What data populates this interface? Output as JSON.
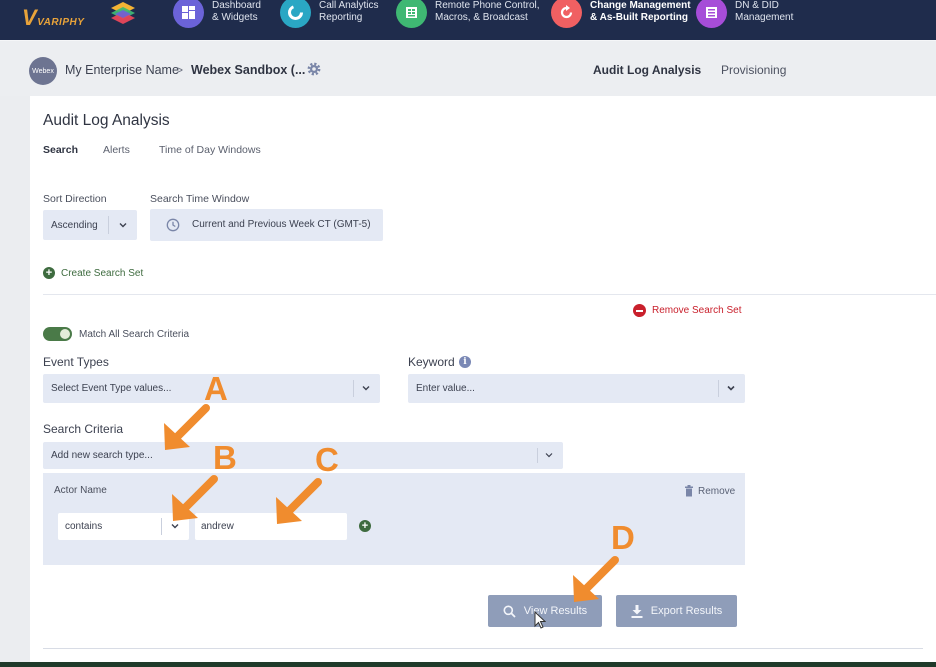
{
  "nav": {
    "logo": "VARIPHY",
    "items": [
      {
        "line1": "Dashboard",
        "line2": "& Widgets",
        "color": "#6b63d8"
      },
      {
        "line1": "Call Analytics",
        "line2": "Reporting",
        "color": "#2aa7c4"
      },
      {
        "line1": "Remote Phone Control,",
        "line2": "Macros, & Broadcast",
        "color": "#3fb873"
      },
      {
        "line1": "Change Management",
        "line2": "& As-Built Reporting",
        "color": "#f06062"
      },
      {
        "line1": "DN & DID",
        "line2": "Management",
        "color": "#a64dd8"
      }
    ]
  },
  "breadcrumb": {
    "avatar": "Webex",
    "enterprise": "My Enterprise Name",
    "separator": ">",
    "cluster": "Webex Sandbox (...",
    "links": [
      "Audit Log Analysis",
      "Provisioning"
    ]
  },
  "page": {
    "title": "Audit Log Analysis",
    "tabs": [
      "Search",
      "Alerts",
      "Time of Day Windows"
    ],
    "sort_direction": {
      "label": "Sort Direction",
      "value": "Ascending"
    },
    "time_window": {
      "label": "Search Time Window",
      "value": "Current and Previous Week CT (GMT-5)"
    },
    "create_search_set": "Create Search Set",
    "remove_search_set": "Remove Search Set",
    "match_all": "Match All Search Criteria",
    "match_all_on": true,
    "event_types": {
      "label": "Event Types",
      "placeholder": "Select Event Type values..."
    },
    "keyword": {
      "label": "Keyword",
      "placeholder": "Enter value..."
    },
    "search_criteria": {
      "label": "Search Criteria",
      "placeholder": "Add new search type..."
    },
    "actor": {
      "label": "Actor Name",
      "remove": "Remove",
      "operator": "contains",
      "value": "andrew"
    },
    "view_results": "View Results",
    "export_results": "Export Results"
  },
  "annotations": [
    "A",
    "B",
    "C",
    "D"
  ],
  "colors": {
    "nav_bg": "#1f2c4c",
    "accent_orange": "#f08c2e",
    "green": "#3e6b3f",
    "red": "#c9202c",
    "button": "#8f9db9"
  }
}
